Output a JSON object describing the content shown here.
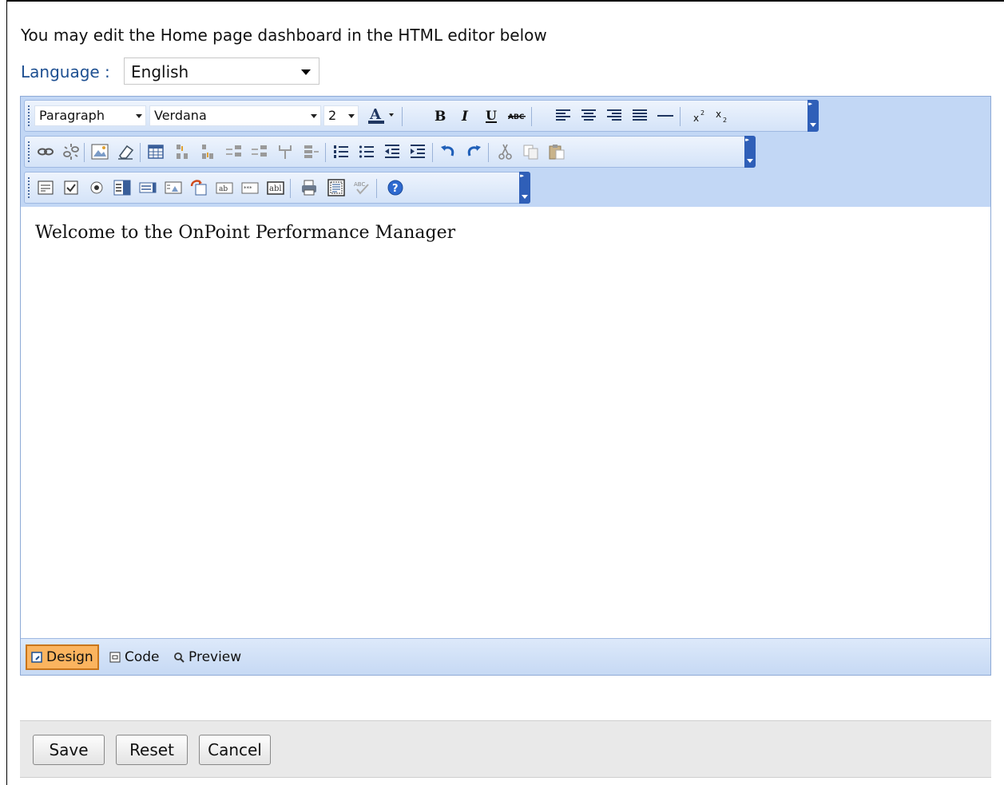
{
  "intro_text": "You may edit the Home page dashboard in the HTML editor below",
  "language": {
    "label": "Language :",
    "selected": "English"
  },
  "editor": {
    "paragraph_format": "Paragraph",
    "font_name": "Verdana",
    "font_size": "2",
    "content_text": "Welcome to the OnPoint Performance Manager",
    "modes": [
      {
        "label": "Design",
        "active": true
      },
      {
        "label": "Code",
        "active": false
      },
      {
        "label": "Preview",
        "active": false
      }
    ],
    "toolbar_row1_icons": [
      "font-color-icon",
      "bold-icon",
      "italic-icon",
      "underline-icon",
      "strikethrough-icon",
      "align-left-icon",
      "align-center-icon",
      "align-right-icon",
      "align-justify-icon",
      "horizontal-rule-icon",
      "superscript-icon",
      "subscript-icon"
    ],
    "toolbar_row2_icons": [
      "link-icon",
      "unlink-icon",
      "insert-image-icon",
      "eraser-icon",
      "insert-table-icon",
      "insert-row-above-icon",
      "insert-row-below-icon",
      "insert-column-left-icon",
      "insert-column-right-icon",
      "merge-cells-icon",
      "split-cell-icon",
      "ordered-list-icon",
      "unordered-list-icon",
      "outdent-icon",
      "indent-icon",
      "undo-icon",
      "redo-icon",
      "cut-icon",
      "copy-icon",
      "paste-icon"
    ],
    "toolbar_row3_icons": [
      "textarea-icon",
      "checkbox-icon",
      "radio-icon",
      "select-list-icon",
      "listbox-icon",
      "image-button-icon",
      "form-icon",
      "text-input-icon",
      "password-input-icon",
      "hidden-field-icon",
      "print-icon",
      "select-all-icon",
      "spellcheck-icon",
      "help-icon"
    ]
  },
  "buttons": {
    "save": "Save",
    "reset": "Reset",
    "cancel": "Cancel"
  },
  "colors": {
    "toolbar_bg": "#c2d7f5",
    "label_blue": "#1d4f91",
    "active_mode": "#fbb45f",
    "footer_bg": "#e9e9e9"
  }
}
